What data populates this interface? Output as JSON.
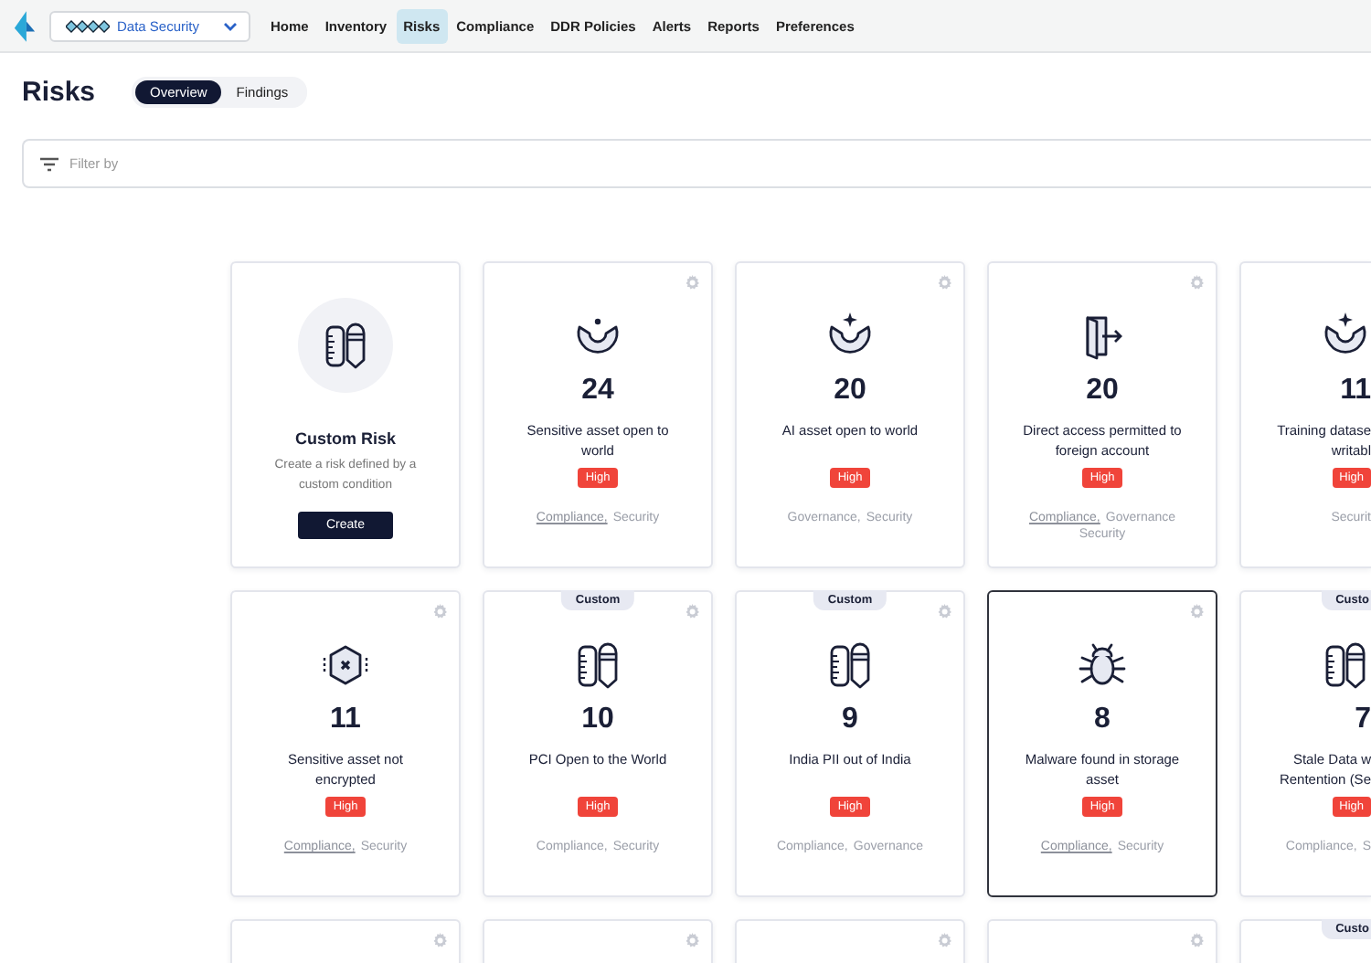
{
  "header": {
    "workspace": {
      "label": "Data Security"
    },
    "nav": [
      {
        "label": "Home",
        "selected": false
      },
      {
        "label": "Inventory",
        "selected": false
      },
      {
        "label": "Risks",
        "selected": true
      },
      {
        "label": "Compliance",
        "selected": false
      },
      {
        "label": "DDR Policies",
        "selected": false
      },
      {
        "label": "Alerts",
        "selected": false
      },
      {
        "label": "Reports",
        "selected": false
      },
      {
        "label": "Preferences",
        "selected": false
      }
    ]
  },
  "page": {
    "title": "Risks",
    "tabs": [
      {
        "label": "Overview",
        "selected": true
      },
      {
        "label": "Findings",
        "selected": false
      }
    ]
  },
  "filter": {
    "placeholder": "Filter by"
  },
  "rows": [
    {
      "cards": [
        {
          "kind": "create",
          "title": "Custom Risk",
          "description": "Create a risk defined by a custom condition",
          "button": "Create",
          "selected": false,
          "settings": false,
          "cut": false
        },
        {
          "kind": "exposure",
          "count": "24",
          "title": "Sensitive asset open to world",
          "severity": "High",
          "tags": [
            {
              "label": "Compliance,",
              "link": true
            },
            {
              "label": "Security",
              "link": false
            }
          ],
          "selected": false,
          "settings": true,
          "cut": false
        },
        {
          "kind": "ai-exposure",
          "count": "20",
          "title": "AI asset open to world",
          "severity": "High",
          "tags": [
            {
              "label": "Governance,",
              "link": false
            },
            {
              "label": "Security",
              "link": false
            }
          ],
          "selected": false,
          "settings": true,
          "cut": false
        },
        {
          "kind": "access",
          "count": "20",
          "title": "Direct access permitted to foreign account",
          "severity": "High",
          "tags": [
            {
              "label": "Compliance,",
              "link": true
            },
            {
              "label": "Governance",
              "link": false
            },
            {
              "label": "Security",
              "link": false
            }
          ],
          "selected": false,
          "settings": true,
          "cut": false
        },
        {
          "kind": "dataset",
          "count": "11",
          "title": "Training datase\nwritabl",
          "severity": "High",
          "tags": [
            {
              "label": "Securit",
              "link": false
            }
          ],
          "selected": false,
          "settings": false,
          "cut": true
        }
      ]
    },
    {
      "cards": [
        {
          "kind": "encryption",
          "count": "11",
          "title": "Sensitive asset not encrypted",
          "severity": "High",
          "tags": [
            {
              "label": "Compliance,",
              "link": true
            },
            {
              "label": "Security",
              "link": false
            }
          ],
          "selected": false,
          "settings": true,
          "cut": false
        },
        {
          "kind": "custom",
          "flag": "Custom",
          "count": "10",
          "title": "PCI Open to the World",
          "severity": "High",
          "tags": [
            {
              "label": "Compliance,",
              "link": false
            },
            {
              "label": "Security",
              "link": false
            }
          ],
          "selected": false,
          "settings": true,
          "cut": false
        },
        {
          "kind": "custom",
          "flag": "Custom",
          "count": "9",
          "title": "India PII out of India",
          "severity": "High",
          "tags": [
            {
              "label": "Compliance,",
              "link": false
            },
            {
              "label": "Governance",
              "link": false
            }
          ],
          "selected": false,
          "settings": true,
          "cut": false
        },
        {
          "kind": "malware",
          "count": "8",
          "title": "Malware found in storage asset",
          "severity": "High",
          "tags": [
            {
              "label": "Compliance,",
              "link": true
            },
            {
              "label": "Security",
              "link": false
            }
          ],
          "selected": true,
          "settings": true,
          "cut": false
        },
        {
          "kind": "custom",
          "flag": "Custo",
          "count": "7",
          "title": "Stale Data w\nRentention (Se",
          "severity": "High",
          "tags": [
            {
              "label": "Compliance,",
              "link": false
            },
            {
              "label": "S",
              "link": false
            }
          ],
          "selected": false,
          "settings": false,
          "cut": true
        }
      ]
    },
    {
      "cards": [
        {
          "kind": "hidden",
          "selected": false,
          "settings": true,
          "cut": false
        },
        {
          "kind": "hidden",
          "selected": false,
          "settings": true,
          "cut": false
        },
        {
          "kind": "hidden",
          "selected": false,
          "settings": true,
          "cut": false
        },
        {
          "kind": "hidden",
          "selected": false,
          "settings": true,
          "cut": false
        },
        {
          "kind": "hidden",
          "flag": "Custo",
          "selected": false,
          "settings": false,
          "cut": true
        }
      ]
    }
  ]
}
